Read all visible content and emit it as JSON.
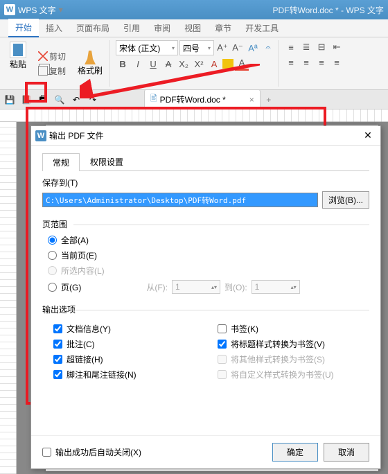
{
  "titlebar": {
    "app": "WPS 文字",
    "doc": "PDF转Word.doc * - WPS 文字",
    "dropdown": "▾"
  },
  "menu": {
    "items": [
      "开始",
      "插入",
      "页面布局",
      "引用",
      "审阅",
      "视图",
      "章节",
      "开发工具"
    ],
    "active": 0
  },
  "ribbon": {
    "paste": "粘贴",
    "cut": "剪切",
    "copy": "复制",
    "format_painter": "格式刷",
    "font": "宋体 (正文)",
    "size": "四号",
    "bold": "B",
    "italic": "I",
    "underline": "U",
    "strike": "A",
    "sub": "X₂",
    "sup": "X²"
  },
  "tab": {
    "name": "PDF转Word.doc *",
    "close": "×",
    "add": "+"
  },
  "dialog": {
    "title": "输出 PDF 文件",
    "tabs": [
      "常规",
      "权限设置"
    ],
    "save_to": "保存到(T)",
    "path": "C:\\Users\\Administrator\\Desktop\\PDF转Word.pdf",
    "browse": "浏览(B)...",
    "range_hdr": "页范围",
    "r_all": "全部(A)",
    "r_current": "当前页(E)",
    "r_selection": "所选内容(L)",
    "r_pages": "页(G)",
    "from": "从(F):",
    "from_v": "1",
    "to": "到(O):",
    "to_v": "1",
    "opts_hdr": "输出选项",
    "o_docinfo": "文档信息(Y)",
    "o_comments": "批注(C)",
    "o_links": "超链接(H)",
    "o_footnotes": "脚注和尾注链接(N)",
    "o_bookmarks": "书签(K)",
    "o_headings": "将标题样式转换为书签(V)",
    "o_other": "将其他样式转换为书签(S)",
    "o_custom": "将自定义样式转换为书签(U)",
    "auto_close": "输出成功后自动关闭(X)",
    "ok": "确定",
    "cancel": "取消"
  }
}
